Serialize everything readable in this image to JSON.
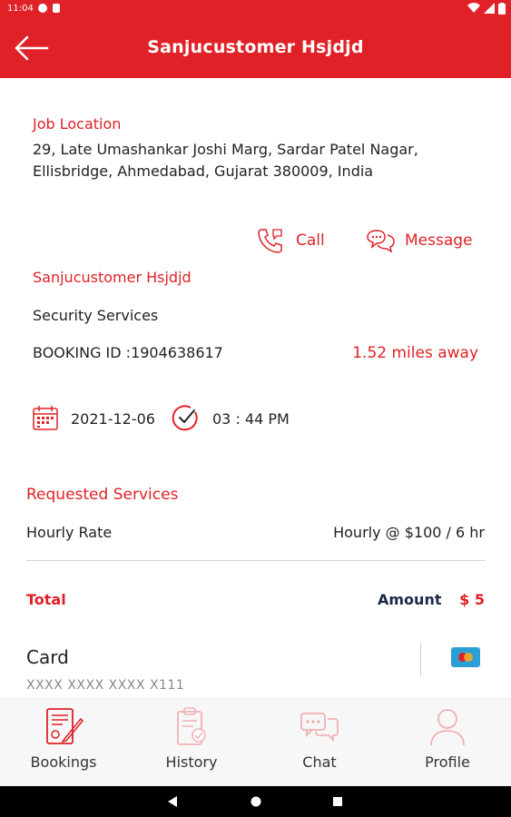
{
  "status": {
    "time": "11:04"
  },
  "header": {
    "title": "Sanjucustomer Hsjdjd"
  },
  "job": {
    "location_label": "Job Location",
    "address_line1": "29, Late Umashankar Joshi Marg, Sardar Patel Nagar,",
    "address_line2": "Ellisbridge, Ahmedabad, Gujarat 380009, India"
  },
  "actions": {
    "call_label": "Call",
    "message_label": "Message"
  },
  "customer": {
    "name": "Sanjucustomer Hsjdjd",
    "service": "Security Services",
    "booking_id": "BOOKING ID :1904638617",
    "distance": "1.52 miles away",
    "date": "2021-12-06",
    "time": "03 : 44 PM"
  },
  "services": {
    "heading": "Requested Services",
    "item_name": "Hourly Rate",
    "item_value": "Hourly @ $100 / 6 hr"
  },
  "total": {
    "label": "Total",
    "amount_label": "Amount",
    "amount_value": "$ 5"
  },
  "payment": {
    "method": "Card",
    "masked_number": "XXXX XXXX XXXX X111"
  },
  "nav": {
    "items": [
      {
        "label": "Bookings"
      },
      {
        "label": "History"
      },
      {
        "label": "Chat"
      },
      {
        "label": "Profile"
      }
    ]
  },
  "colors": {
    "brand": "#e02127",
    "dark_text": "#222222",
    "nav_icon_muted": "#f1b1b3"
  }
}
